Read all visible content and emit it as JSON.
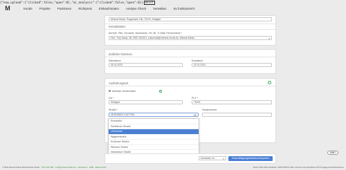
{
  "debug": {
    "text": "{\"new_upload\":{\"clicked\":false,\"open\":0},\"ai_analysis\":{\"clicked\":false,\"open\":0}}",
    "reset": "Reset"
  },
  "nav": {
    "logo": "M",
    "items": [
      "Kunde",
      "Projekte",
      "Positionen",
      "Richtpreis",
      "Einkaufsmaten",
      "Analyse Check",
      "Verwalten",
      "Su funktioniert's"
    ]
  },
  "top_field": {
    "value": "Mineral Minds, Pragstraße 136, 70376, Stuttgart"
  },
  "contact": {
    "title": "Kontaktdaten",
    "label": "Anrede, Titel, Vorname, Nachname, Tel.-Nr., E-Mail, Firmenname *",
    "value": "Herr, Tmÿ Swaa, 3B, 0987-624221, suksenda@mineral-minds.de, Mineral Minds"
  },
  "period": {
    "title": "Zeitlicher Rahmen",
    "start_label": "Startdatum",
    "start_value": "05.01.2023",
    "end_label": "Enddatum",
    "end_value": "02.01.2024"
  },
  "location": {
    "title": "Ausführungsort",
    "checkbox_label": "Adresse verwechseln",
    "city_label": "Ort *",
    "city_value": "Stuttgart",
    "plz_label": "PLZ *",
    "plz_value": "70376",
    "street_label": "Straße *",
    "street_value": "48.8115621,9.1677421",
    "number_label": "Hausnummer"
  },
  "dropdown": {
    "options": [
      "Ensstraße",
      "Schlittener Straße",
      "Uferstraße",
      "Wagnerstraße",
      "Kröönner Straße",
      "Wiesner Straße",
      "Neckaraue Straße",
      "James F. Byrnes-Straße"
    ],
    "selected_index": 2
  },
  "bottom": {
    "select_placeholder": "Ausbauen on...",
    "primary_label": "Entschädigungsbetriebs Interpreten"
  },
  "help": {
    "label": "Hilfe?"
  },
  "footer": {
    "left_prefix": "© 2024 Mineral Minds Deutschland GmbH · ",
    "links": [
      "0711 123 456",
      "info@mineral-minds.de",
      "Impressum",
      "AGB",
      "Datenschutz"
    ],
    "right": "Seiten ESC Mineral Minds | SDT/NTRISI URL of Frame http://localhost:3277/engagement/1/Positionen"
  },
  "colors": {
    "primary": "#4a7fd4",
    "success": "#3aa35b"
  }
}
